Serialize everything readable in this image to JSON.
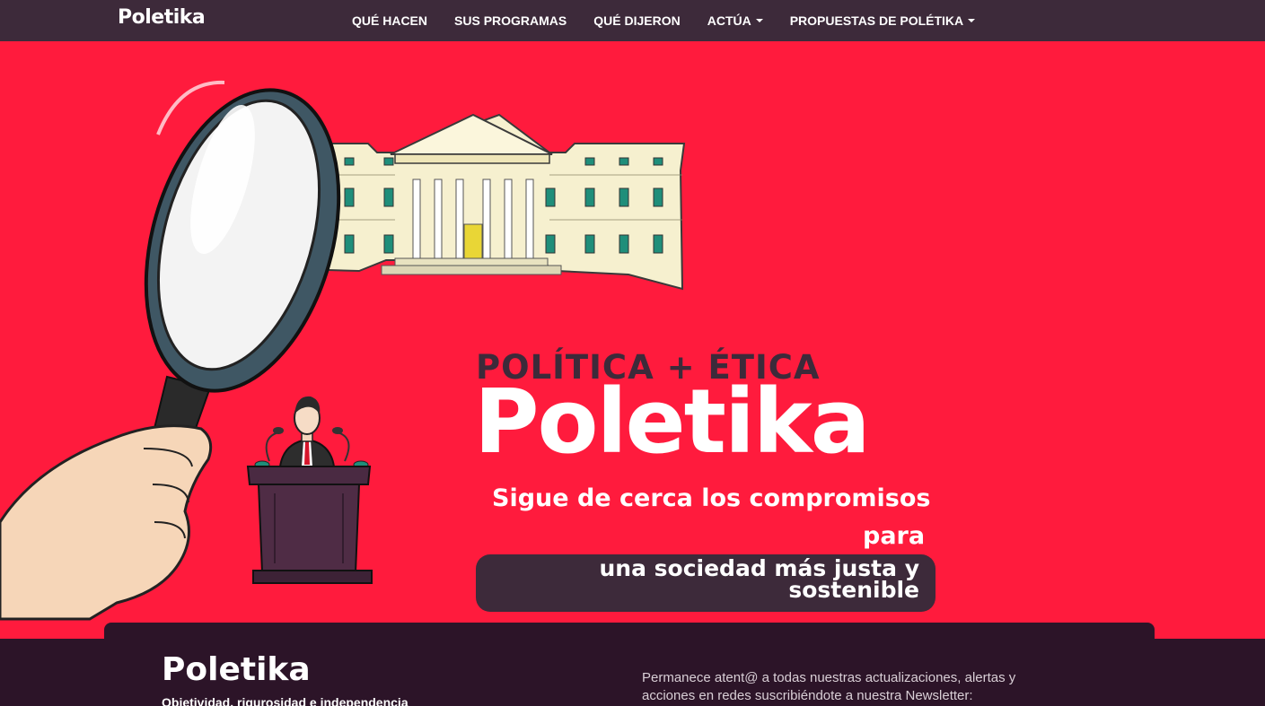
{
  "nav": {
    "brand": "Poletika",
    "items": [
      {
        "label": "QUÉ HACEN",
        "dropdown": false
      },
      {
        "label": "SUS PROGRAMAS",
        "dropdown": false
      },
      {
        "label": "QUÉ DIJERON",
        "dropdown": false
      },
      {
        "label": "ACTÚA",
        "dropdown": true
      },
      {
        "label": "PROPUESTAS DE POLÉTIKA",
        "dropdown": true
      }
    ]
  },
  "hero": {
    "kicker": "POLÍTICA + ÉTICA",
    "title": "Poletika",
    "tagline_1": "Sigue de cerca los compromisos",
    "tagline_2": "para",
    "tagline_3": "una sociedad más justa y sostenible"
  },
  "footer": {
    "title": "Poletika",
    "tagline": "Objetividad, rigurosidad e independencia",
    "newsletter_text": "Permanece atent@ a todas nuestras actualizaciones, alertas y acciones en redes suscribiéndote a nuestra Newsletter:"
  },
  "colors": {
    "brand_red": "#ff1b3d",
    "brand_dark": "#3d2a3a",
    "footer_bg": "#2c1428"
  }
}
